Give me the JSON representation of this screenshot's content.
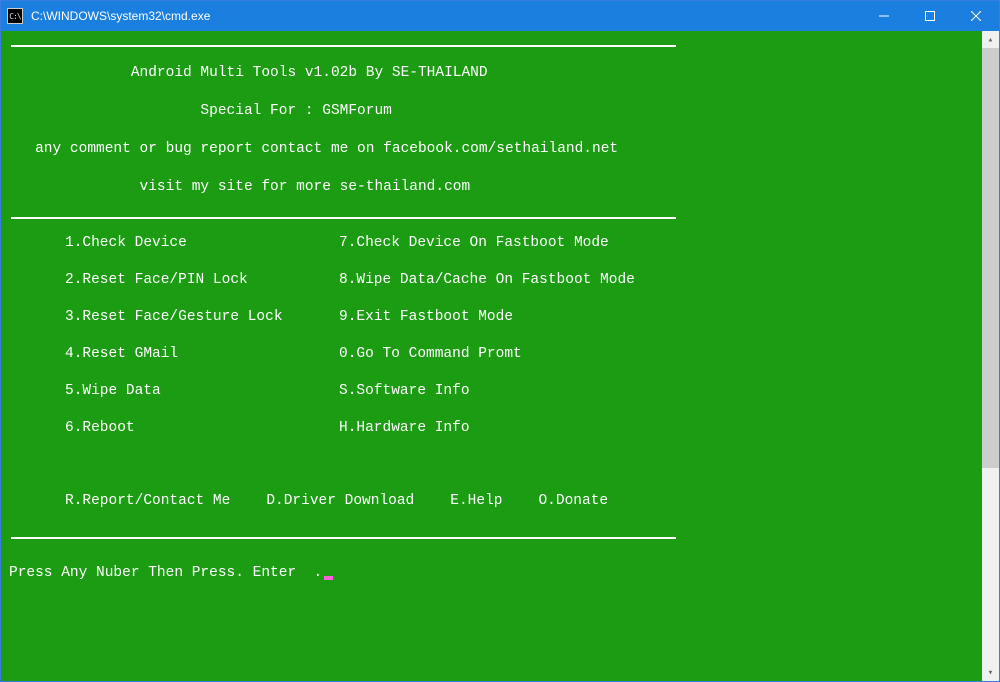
{
  "titlebar": {
    "icon_text": "C:\\",
    "title": "C:\\WINDOWS\\system32\\cmd.exe"
  },
  "header": {
    "line1": "              Android Multi Tools v1.02b By SE-THAILAND",
    "line2": "                      Special For : GSMForum",
    "line3": "   any comment or bug report contact me on facebook.com/sethailand.net",
    "line4": "               visit my site for more se-thailand.com"
  },
  "menu": {
    "rows": [
      {
        "left": "1.Check Device",
        "right": "7.Check Device On Fastboot Mode"
      },
      {
        "left": "2.Reset Face/PIN Lock",
        "right": "8.Wipe Data/Cache On Fastboot Mode"
      },
      {
        "left": "3.Reset Face/Gesture Lock",
        "right": "9.Exit Fastboot Mode"
      },
      {
        "left": "4.Reset GMail",
        "right": "0.Go To Command Promt"
      },
      {
        "left": "5.Wipe Data",
        "right": "S.Software Info"
      },
      {
        "left": "6.Reboot",
        "right": "H.Hardware Info"
      }
    ]
  },
  "extras": {
    "report": "R.Report/Contact Me",
    "driver": "D.Driver Download",
    "help": "E.Help",
    "donate": "O.Donate"
  },
  "prompt": {
    "text": "Press Any Nuber Then Press. Enter  ."
  }
}
